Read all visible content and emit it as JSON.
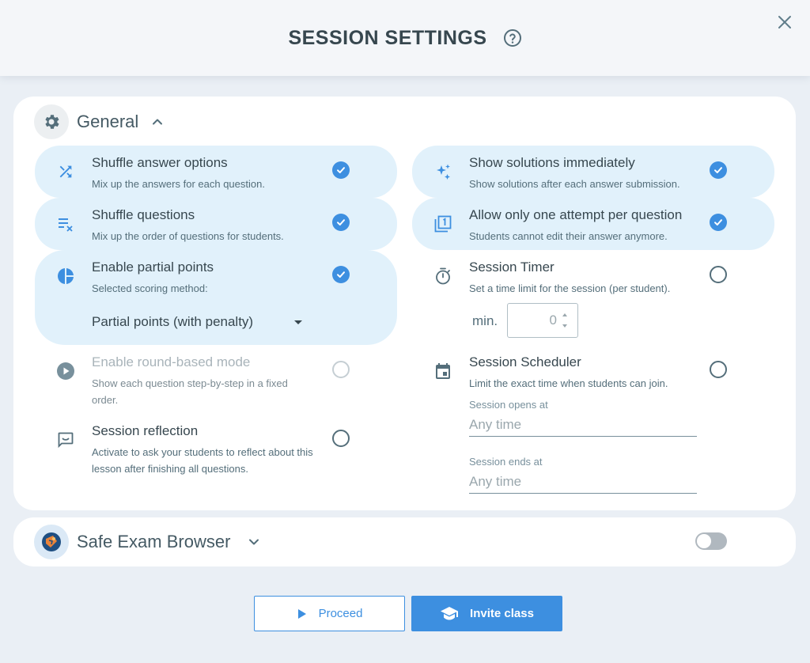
{
  "dialog": {
    "title": "SESSION SETTINGS"
  },
  "general": {
    "title": "General",
    "left_options": [
      {
        "title": "Shuffle answer options",
        "description": "Mix up the answers for each question.",
        "checked": true
      },
      {
        "title": "Shuffle questions",
        "description": "Mix up the order of questions for students.",
        "checked": true
      },
      {
        "title": "Enable partial points",
        "description": "Selected scoring method:",
        "checked": true,
        "select_value": "Partial points (with penalty)"
      },
      {
        "title": "Enable round-based mode",
        "description": "Show each question step-by-step in a fixed order.",
        "checked": false,
        "disabled": true
      },
      {
        "title": "Session reflection",
        "description": "Activate to ask your students to reflect about this lesson after finishing all questions.",
        "checked": false
      }
    ],
    "right_options": [
      {
        "title": "Show solutions immediately",
        "description": "Show solutions after each answer submission.",
        "checked": true
      },
      {
        "title": "Allow only one attempt per question",
        "description": "Students cannot edit their answer anymore.",
        "checked": true
      },
      {
        "title": "Session Timer",
        "description": "Set a time limit for the session (per student).",
        "checked": false,
        "min_label": "min.",
        "min_value": "0"
      },
      {
        "title": "Session Scheduler",
        "description": "Limit the exact time when students can join.",
        "checked": false,
        "opens_label": "Session opens at",
        "opens_placeholder": "Any time",
        "ends_label": "Session ends at",
        "ends_placeholder": "Any time"
      }
    ]
  },
  "seb": {
    "title": "Safe Exam Browser",
    "enabled": false
  },
  "footer": {
    "proceed_label": "Proceed",
    "invite_label": "Invite class"
  },
  "colors": {
    "accent": "#3d8fe0",
    "active_bg": "#e1f1fb",
    "text": "#37474f"
  }
}
